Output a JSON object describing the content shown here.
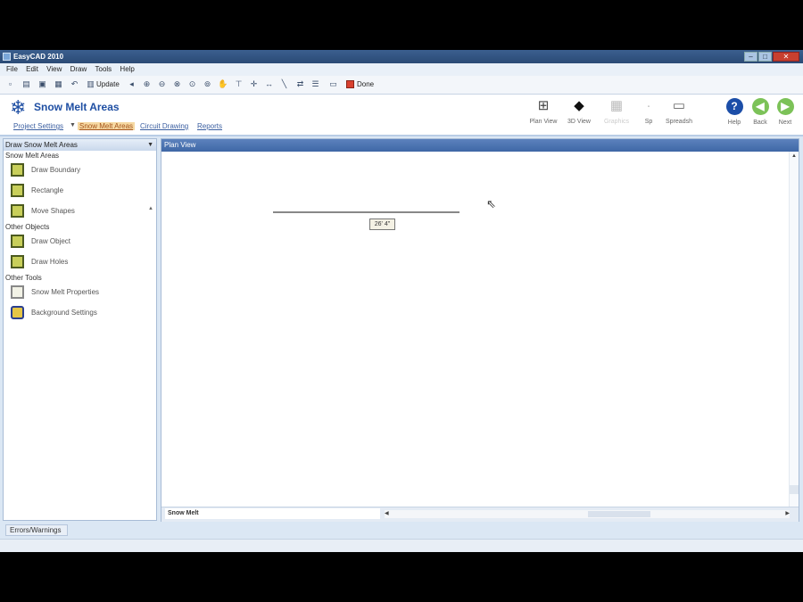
{
  "window": {
    "title": "EasyCAD 2010",
    "min": "–",
    "max": "□",
    "close": "✕"
  },
  "menu": [
    "File",
    "Edit",
    "View",
    "Draw",
    "Tools",
    "Help"
  ],
  "toolbar": {
    "update_label": "Update",
    "done_label": "Done"
  },
  "ribbon": {
    "title": "Snow Melt Areas",
    "tabs": [
      "Project Settings",
      "Snow Melt Areas",
      "Circuit Drawing",
      "Reports"
    ],
    "tab_arrow": "▼",
    "buttons": {
      "plan_view": "Plan View",
      "view_3d": "3D View",
      "disabled": "Graphics",
      "sp": "Sp",
      "spreadsheet": "Spreadsh",
      "help": "Help",
      "back": "Back",
      "next": "Next"
    }
  },
  "left_panel": {
    "header": "Draw Snow Melt Areas",
    "pin": "▼",
    "section_areas": "Snow Melt Areas",
    "draw_boundary": "Draw Boundary",
    "rectangle": "Rectangle",
    "move_shapes": "Move Shapes",
    "section_objects": "Other Objects",
    "draw_object": "Draw Object",
    "draw_holes": "Draw Holes",
    "section_tools": "Other Tools",
    "properties": "Snow Melt Properties",
    "background": "Background Settings"
  },
  "plan_view": {
    "header": "Plan View",
    "dimension": "26' 4\""
  },
  "bottom": {
    "sheet_tab": "Snow Melt",
    "errors_tab": "Errors/Warnings"
  }
}
